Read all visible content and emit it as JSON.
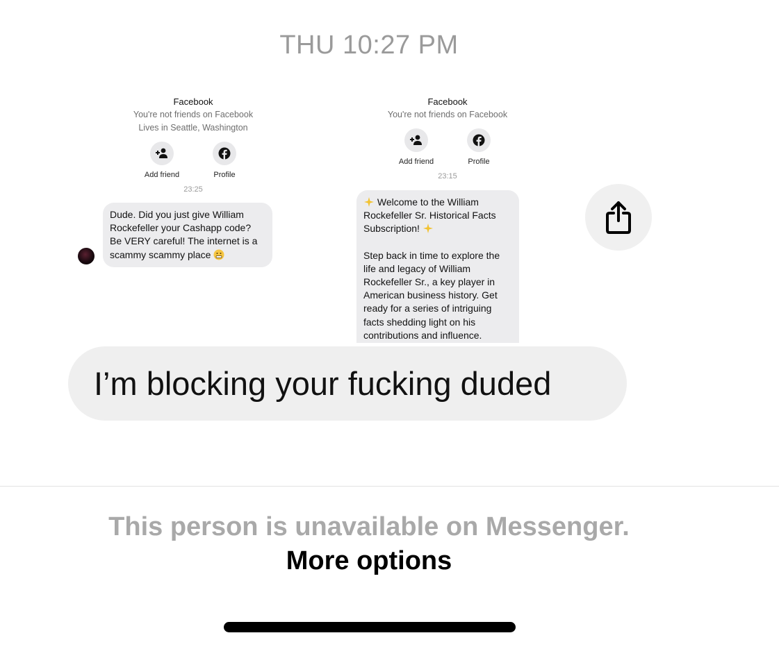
{
  "header": {
    "timestamp": "THU 10:27 PM"
  },
  "screenshot_1": {
    "network": "Facebook",
    "friend_status": "You're not friends on Facebook",
    "location": "Lives in Seattle, Washington",
    "add_friend_label": "Add friend",
    "profile_label": "Profile",
    "time": "23:25",
    "message": "Dude. Did you just give William Rockefeller your Cashapp code? Be VERY careful! The internet is a scammy scammy place"
  },
  "screenshot_2": {
    "network": "Facebook",
    "friend_status": "You're not friends on Facebook",
    "add_friend_label": "Add friend",
    "profile_label": "Profile",
    "time": "23:15",
    "message_title": "Welcome to the William Rockefeller Sr. Historical Facts Subscription!",
    "message_body": "Step back in time to explore the life and legacy of William Rockefeller Sr., a key player in American business history. Get ready for a series of intriguing facts shedding light on his contributions and influence."
  },
  "message": {
    "text": "I’m blocking your fucking duded"
  },
  "footer": {
    "unavailable_text": "This person is unavailable on Messenger.",
    "more_options_label": "More options"
  },
  "icons": {
    "share": "share-icon",
    "add_friend": "add-person-icon",
    "profile": "facebook-icon",
    "sparkle": "sparkles-emoji",
    "grimace": "grimacing-emoji"
  }
}
